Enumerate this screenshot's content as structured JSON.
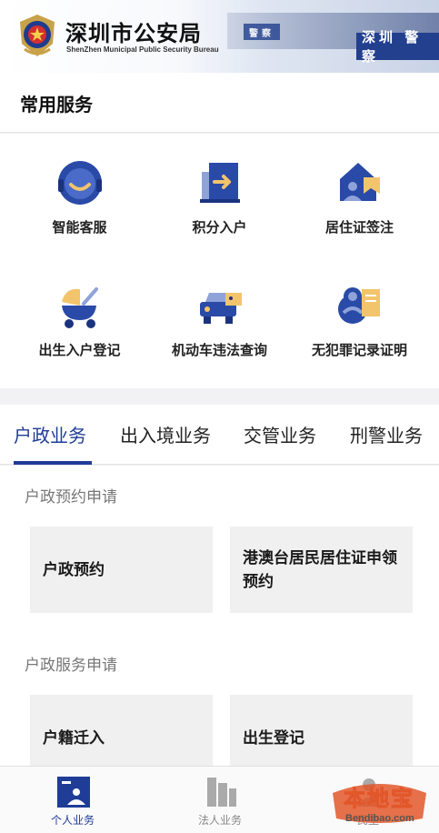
{
  "header": {
    "title": "深圳市公安局",
    "subtitle": "ShenZhen Municipal Public Security Bureau",
    "banner_text_1": "警察",
    "banner_text_2": "深圳 警察"
  },
  "common_services": {
    "heading": "常用服务",
    "items": [
      {
        "label": "智能客服",
        "icon": "customer-service-icon"
      },
      {
        "label": "积分入户",
        "icon": "points-household-icon"
      },
      {
        "label": "居住证签注",
        "icon": "residence-permit-icon"
      },
      {
        "label": "出生入户登记",
        "icon": "birth-registration-icon"
      },
      {
        "label": "机动车违法查询",
        "icon": "vehicle-violation-icon"
      },
      {
        "label": "无犯罪记录证明",
        "icon": "no-criminal-record-icon"
      }
    ]
  },
  "tabs": [
    {
      "label": "户政业务",
      "active": true
    },
    {
      "label": "出入境业务",
      "active": false
    },
    {
      "label": "交管业务",
      "active": false
    },
    {
      "label": "刑警业务",
      "active": false
    }
  ],
  "sections": [
    {
      "title": "户政预约申请",
      "cards": [
        "户政预约",
        "港澳台居民居住证申领预约"
      ]
    },
    {
      "title": "户政服务申请",
      "cards": [
        "户籍迁入",
        "出生登记"
      ]
    }
  ],
  "bottom_nav": [
    {
      "label": "个人业务",
      "active": true
    },
    {
      "label": "法人业务",
      "active": false
    },
    {
      "label": "民生",
      "active": false
    }
  ],
  "watermark": {
    "text": "本地宝",
    "sub": "Bendibao.com"
  },
  "colors": {
    "accent": "#1f3c97",
    "icon_blue": "#2a4aa8",
    "icon_yellow": "#f2c46b"
  }
}
